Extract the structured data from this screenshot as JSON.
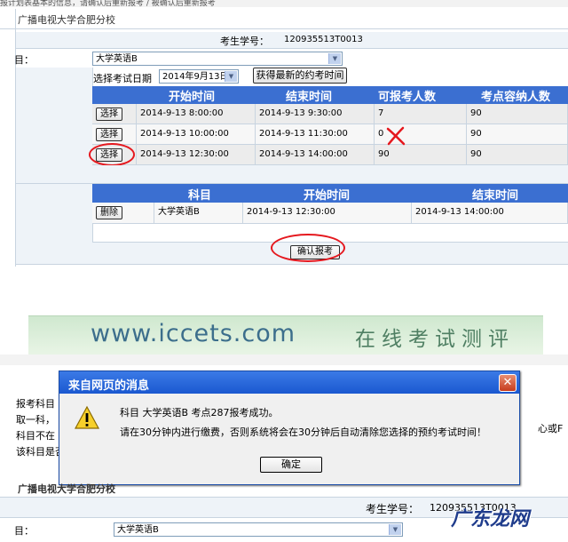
{
  "top": {
    "cut_text": "报计划表基本的信息，请确认后重新报考 / 被确认后重新报考",
    "school": "广播电视大学合肥分校",
    "student_label": "考生学号：",
    "student_id": "120935513T0013",
    "subject_label": "目：",
    "subject_value": "大学英语B",
    "date_label": "选择考试日期",
    "date_value": "2014年9月13日",
    "refresh_button": "获得最新的约考时间",
    "time_table": {
      "headers": [
        "开始时间",
        "结束时间",
        "可报考人数",
        "考点容纳人数"
      ],
      "select_label": "选择",
      "rows": [
        {
          "start": "2014-9-13 8:00:00",
          "end": "2014-9-13 9:30:00",
          "available": "7",
          "capacity": "90"
        },
        {
          "start": "2014-9-13 10:00:00",
          "end": "2014-9-13 11:30:00",
          "available": "0",
          "capacity": "90"
        },
        {
          "start": "2014-9-13 12:30:00",
          "end": "2014-9-13 14:00:00",
          "available": "90",
          "capacity": "90"
        }
      ]
    },
    "selected_table": {
      "headers": [
        "科目",
        "开始时间",
        "结束时间"
      ],
      "delete_label": "删除",
      "row": {
        "subject": "大学英语B",
        "start": "2014-9-13 12:30:00",
        "end": "2014-9-13 14:00:00"
      }
    },
    "confirm_button": "确认报考"
  },
  "bottom": {
    "banner_url": "www.iccets.com",
    "banner_text": "在线考试测评",
    "bg_left_lines": [
      "报考科目",
      "取一科，",
      "科目不在",
      "该科目是否"
    ],
    "bg_right_text": "心或F",
    "school": "广播电视大学合肥分校",
    "student_label": "考生学号：",
    "student_id": "120935513T0013",
    "subject_label": "目：",
    "subject_value": "大学英语B"
  },
  "dialog": {
    "title": "来自网页的消息",
    "line1": "科目 大学英语B 考点287报考成功。",
    "line2": "请在30分钟内进行缴费，否则系统将会在30分钟后自动清除您选择的预约考试时间！",
    "ok_button": "确定"
  },
  "watermark": "广东龙网",
  "colors": {
    "header_blue": "#3b6fd1",
    "annotation_red": "#e5181e",
    "dialog_title": "#1a58d0"
  }
}
